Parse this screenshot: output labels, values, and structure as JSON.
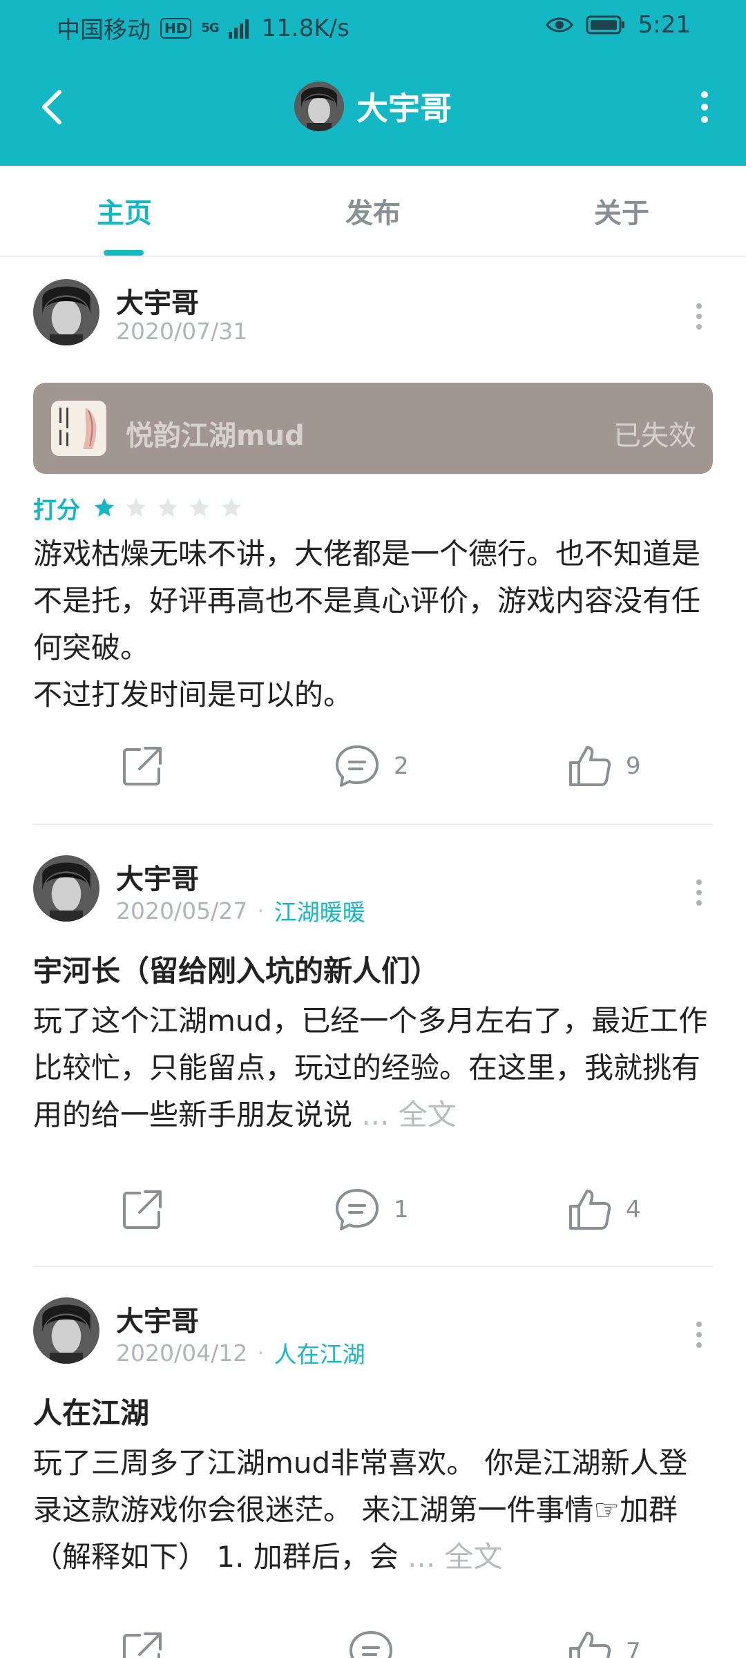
{
  "status_bar": {
    "carrier": "中国移动",
    "hd": "HD",
    "network": "5G",
    "speed": "11.8K/s",
    "time": "5:21"
  },
  "header": {
    "title": "大宇哥",
    "accent_color": "#14b8c4"
  },
  "tabs": [
    {
      "label": "主页",
      "active": true
    },
    {
      "label": "发布",
      "active": false
    },
    {
      "label": "关于",
      "active": false
    }
  ],
  "posts": [
    {
      "author": "大宇哥",
      "date": "2020/07/31",
      "topic": "",
      "game": {
        "name": "悦韵江湖mud",
        "status": "已失效",
        "icon_text": "悦韵江湖"
      },
      "rating_label": "打分",
      "rating": 1,
      "rating_max": 5,
      "body": "游戏枯燥无味不讲，大佬都是一个德行。也不知道是不是托，好评再高也不是真心评价，游戏内容没有任何突破。\n不过打发时间是可以的。",
      "comments": "2",
      "likes": "9"
    },
    {
      "author": "大宇哥",
      "date": "2020/05/27",
      "topic": "江湖暖暖",
      "title": "宇河长（留给刚入坑的新人们）",
      "body": "玩了这个江湖mud，已经一个多月左右了，最近工作比较忙，只能留点，玩过的经验。在这里，我就挑有用的给一些新手朋友说说",
      "ellipsis": " ...",
      "more": " 全文",
      "comments": "1",
      "likes": "4"
    },
    {
      "author": "大宇哥",
      "date": "2020/04/12",
      "topic": "人在江湖",
      "title": "人在江湖",
      "body": "玩了三周多了江湖mud非常喜欢。 你是江湖新人登录这款游戏你会很迷茫。 来江湖第一件事情☞加群（解释如下） 1. 加群后，会",
      "ellipsis": " ...",
      "more": " 全文",
      "comments": "",
      "likes": "7"
    }
  ]
}
